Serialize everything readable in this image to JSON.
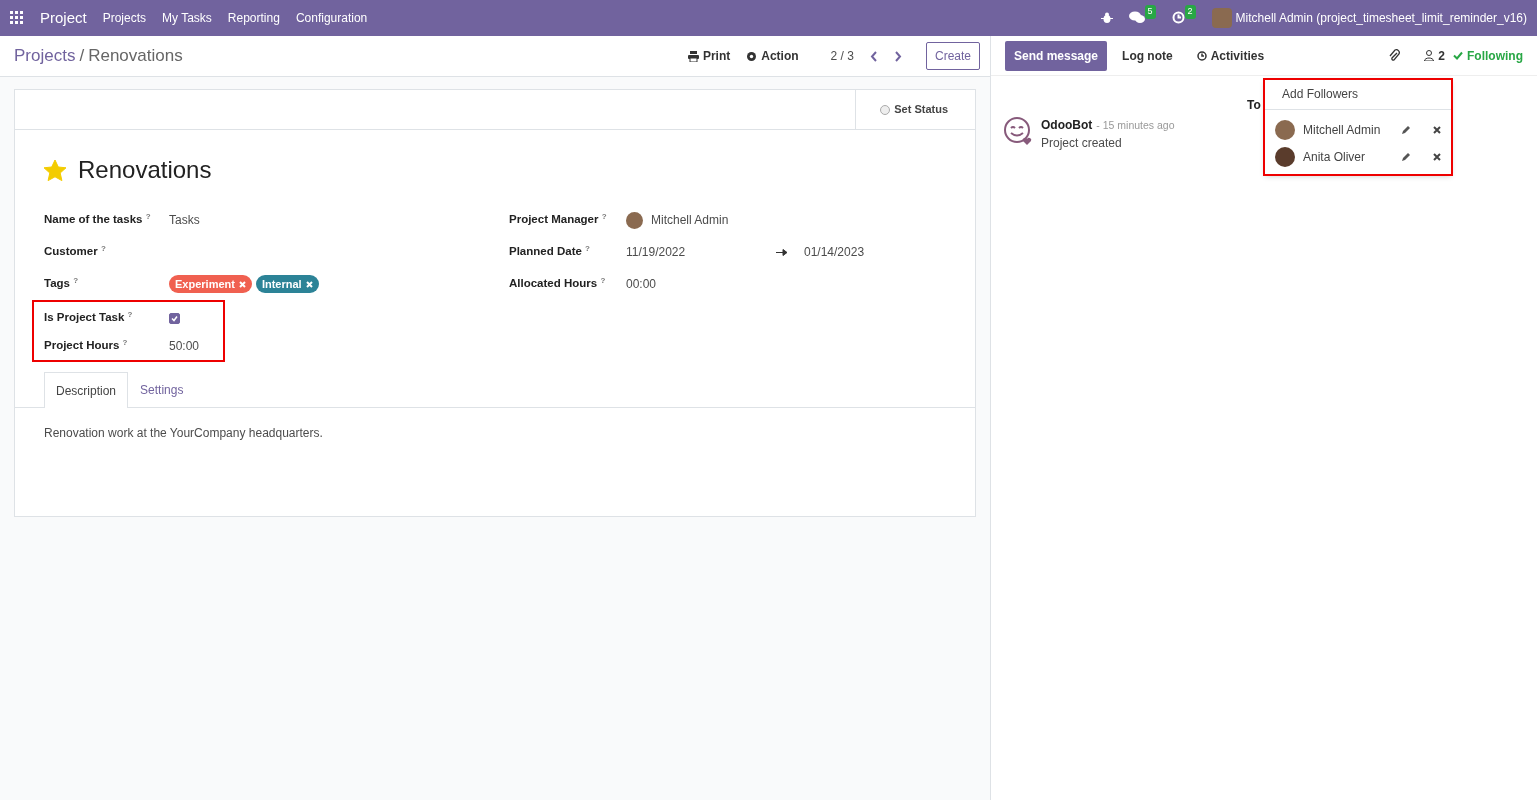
{
  "navbar": {
    "app": "Project",
    "menu": [
      "Projects",
      "My Tasks",
      "Reporting",
      "Configuration"
    ],
    "messages_count": "5",
    "activities_count": "2",
    "user": "Mitchell Admin (project_timesheet_limit_reminder_v16)"
  },
  "breadcrumb": {
    "parent": "Projects",
    "separator": "/",
    "current": "Renovations"
  },
  "control_panel": {
    "print": "Print",
    "action": "Action",
    "pager": "2 / 3",
    "create": "Create"
  },
  "status": {
    "label": "Set Status"
  },
  "record": {
    "title": "Renovations",
    "favorite": true
  },
  "left_fields": [
    {
      "kind": "text",
      "label": "Name of the tasks",
      "help": "?",
      "value": "Tasks",
      "highlighted": false
    },
    {
      "kind": "text",
      "label": "Customer",
      "help": "?",
      "highlighted": false
    },
    {
      "kind": "tags",
      "label": "Tags",
      "help": "?",
      "tags": [
        {
          "name": "Experiment",
          "color": "#f06050"
        },
        {
          "name": "Internal",
          "color": "#2c8397"
        }
      ],
      "highlighted": false
    },
    {
      "kind": "checkbox",
      "label": "Is Project Task",
      "help": "?",
      "checked": true,
      "highlighted": true
    },
    {
      "kind": "text",
      "label": "Project Hours",
      "help": "?",
      "value": "50:00",
      "highlighted": true
    }
  ],
  "right_fields": [
    {
      "kind": "user",
      "label": "Project Manager",
      "help": "?",
      "value": "Mitchell Admin"
    },
    {
      "kind": "daterange",
      "label": "Planned Date",
      "help": "?",
      "start": "11/19/2022",
      "end": "01/14/2023"
    },
    {
      "kind": "text",
      "label": "Allocated Hours",
      "help": "?",
      "value": "00:00"
    }
  ],
  "notebook": {
    "tabs": [
      {
        "label": "Description",
        "selected": true
      },
      {
        "label": "Settings",
        "selected": false
      }
    ],
    "content": "Renovation work at the YourCompany headquarters."
  },
  "chatter": {
    "buttons": [
      {
        "label": "Send message",
        "selected": true
      },
      {
        "label": "Log note",
        "selected": false
      },
      {
        "label": "Activities",
        "selected": false
      }
    ],
    "followers_count": "2",
    "following": "Following",
    "date_separator": "To",
    "messages": [
      {
        "author": "OdooBot",
        "time": "- 15 minutes ago",
        "body": "Project created"
      }
    ]
  },
  "followers_dropdown": {
    "add": "Add Followers",
    "followers": [
      {
        "name": "Mitchell Admin"
      },
      {
        "name": "Anita Oliver"
      }
    ],
    "highlighted": true
  }
}
